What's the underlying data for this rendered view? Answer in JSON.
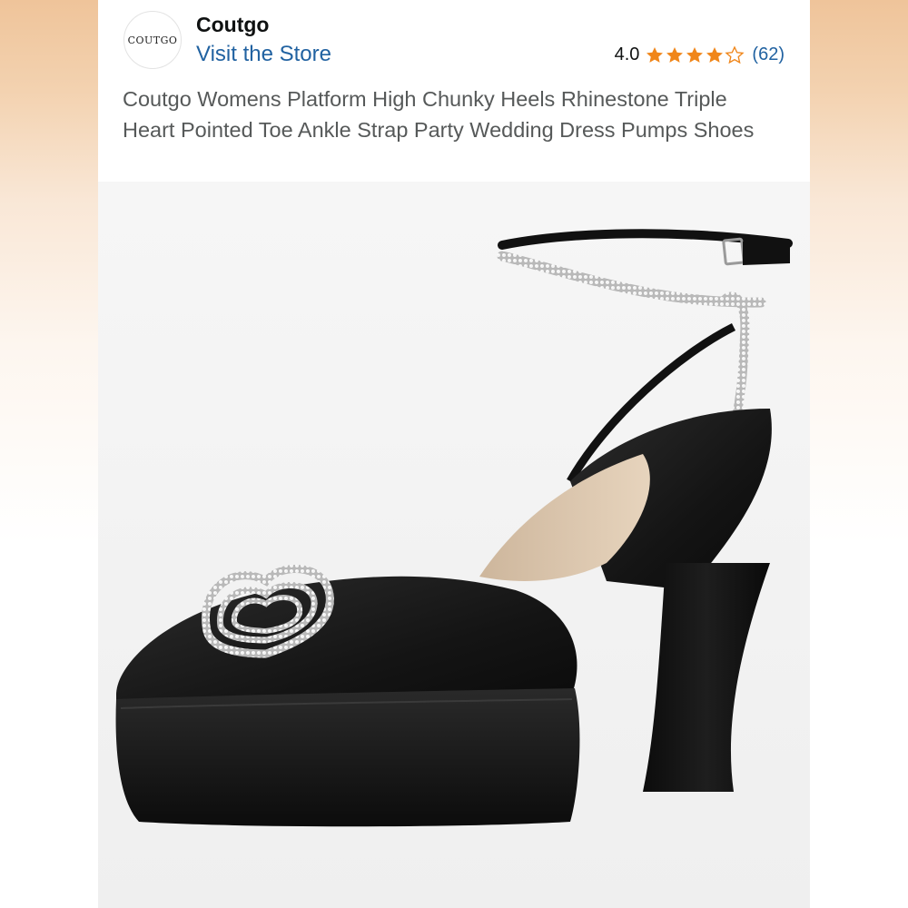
{
  "store": {
    "logo_text": "COUTGO",
    "brand_name": "Coutgo",
    "visit_link": "Visit the Store"
  },
  "rating": {
    "value": "4.0",
    "stars_filled": 4,
    "stars_total": 5,
    "count": "(62)",
    "star_color": "#f0861a"
  },
  "product": {
    "title": "Coutgo Womens Platform High Chunky Heels Rhinestone Triple Heart Pointed Toe Ankle Strap Party Wedding Dress Pumps Shoes",
    "image": "black-platform-heel-with-rhinestone-heart-and-ankle-strap"
  },
  "colors": {
    "link": "#2162a1",
    "title_text": "#565959"
  }
}
